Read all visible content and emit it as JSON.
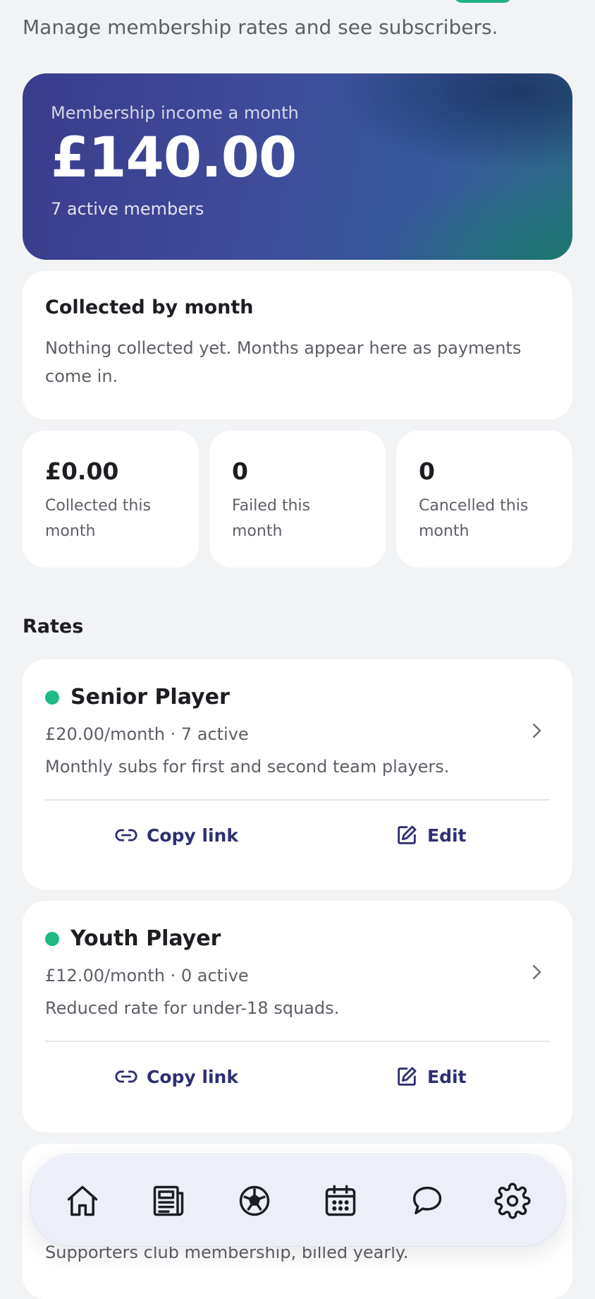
{
  "header": {
    "subtitle": "Manage membership rates and see subscribers."
  },
  "hero": {
    "label": "Membership income a month",
    "amount": "£140.00",
    "members": "7 active members"
  },
  "collected_by_month": {
    "title": "Collected by month",
    "empty_text": "Nothing collected yet. Months appear here as payments come in."
  },
  "stats": [
    {
      "value": "£0.00",
      "label": "Collected this month"
    },
    {
      "value": "0",
      "label": "Failed this month"
    },
    {
      "value": "0",
      "label": "Cancelled this month"
    }
  ],
  "rates_section": {
    "title": "Rates",
    "items": [
      {
        "name": "Senior Player",
        "price": "£20.00/month · 7 active",
        "description": "Monthly subs for first and second team players.",
        "copy_label": "Copy link",
        "edit_label": "Edit",
        "status_color": "#1fb886"
      },
      {
        "name": "Youth Player",
        "price": "£12.00/month · 0 active",
        "description": "Reduced rate for under-18 squads.",
        "copy_label": "Copy link",
        "edit_label": "Edit",
        "status_color": "#1fb886"
      },
      {
        "description": "Supporters club membership, billed yearly."
      }
    ]
  },
  "bottom_nav": {
    "items": [
      {
        "icon": "home-icon"
      },
      {
        "icon": "news-icon"
      },
      {
        "icon": "football-icon"
      },
      {
        "icon": "calendar-icon"
      },
      {
        "icon": "chat-icon"
      },
      {
        "icon": "settings-icon"
      }
    ]
  },
  "colors": {
    "accent": "#2e2f72",
    "status_active": "#1fb886",
    "hero_start": "#3a3c8c",
    "hero_end": "#2b6c86"
  }
}
